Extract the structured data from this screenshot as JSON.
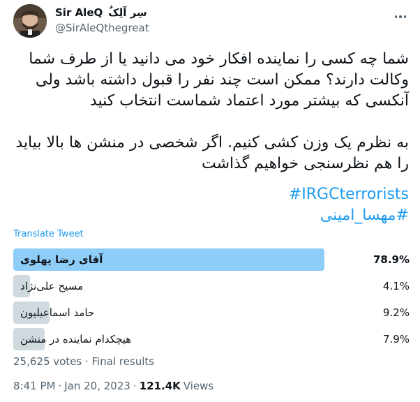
{
  "author": {
    "display_name": "Sir AleQ",
    "display_name_fa": "سِر آلِکٌ",
    "handle": "@SirAleQthegreat"
  },
  "tweet": {
    "paragraph1": [
      "شما چه کسی را نماینده افکار خود می دانید یا از طرف شما",
      "وکالت دارند؟ ممکن است چند نفر را قبول داشته باشد ولی",
      "آنکسی که بیشتر مورد اعتماد شماست انتخاب کنید"
    ],
    "paragraph2": [
      "به نظرم یک وزن کشی کنیم. اگر شخصی در منشن ها بالا بیاید",
      "را هم نظرسنجی خواهیم گذاشت"
    ],
    "hashtags": [
      "#IRGCterrorists",
      "#مهسا_امینی"
    ],
    "translate_label": "Translate Tweet"
  },
  "poll": {
    "options": [
      {
        "label": "آقای رضا پهلوی",
        "percent_label": "78.9%",
        "percent": 78.9,
        "winner": true
      },
      {
        "label": "مسیح علی‌نژاد",
        "percent_label": "4.1%",
        "percent": 4.1,
        "winner": false
      },
      {
        "label": "حامد اسماعیلیون",
        "percent_label": "9.2%",
        "percent": 9.2,
        "winner": false
      },
      {
        "label": "هیچکدام نماینده در منشن",
        "percent_label": "7.9%",
        "percent": 7.9,
        "winner": false
      }
    ],
    "votes_text": "25,625 votes · Final results"
  },
  "meta": {
    "time": "8:41 PM",
    "separator": "·",
    "date": "Jan 20, 2023",
    "views_count": "121.4K",
    "views_label": "Views"
  },
  "colors": {
    "winner_bar": "#8ecdf8",
    "other_bar": "#cfd9de",
    "link": "#1d9bf0"
  }
}
